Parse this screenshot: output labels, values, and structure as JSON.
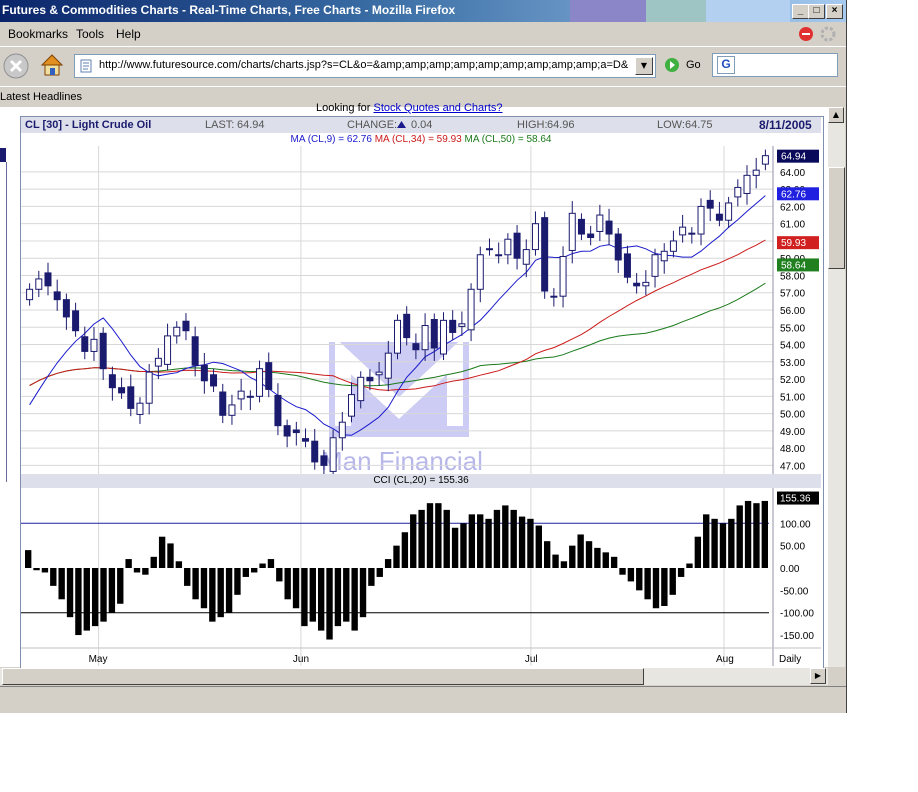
{
  "window": {
    "title": "Futures & Commodities Charts - Real-Time Charts, Free Charts - Mozilla Firefox",
    "min": "_",
    "max": "□",
    "close": "×"
  },
  "menu": [
    "Bookmarks",
    "Tools",
    "Help"
  ],
  "nav": {
    "url": "http://www.futuresource.com/charts/charts.jsp?s=CL&o=&amp;amp;amp;amp;amp;amp;amp;amp;amp;a=D&",
    "go_label": "Go",
    "search_value": "G"
  },
  "bookmarks": {
    "item": "Latest Headlines"
  },
  "page": {
    "link_prefix": "Looking for ",
    "link_text": "Stock Quotes and Charts?"
  },
  "chart_header": {
    "symbol": "CL [30] - Light Crude Oil",
    "last_label": "LAST:",
    "last": "64.94",
    "change_label": "CHANGE:",
    "change": "0.04",
    "high_label": "HIGH:",
    "high": "64.96",
    "low_label": "LOW:",
    "low": "64.75",
    "date": "8/11/2005"
  },
  "ma_legend": {
    "ma9": "MA (CL,9) = 62.76",
    "ma34": "MA (CL,34) = 59.93",
    "ma50": "MA (CL,50) = 58.64",
    "colors": {
      "ma9": "#1a1acc",
      "ma34": "#cc1a1a",
      "ma50": "#1a7a1a",
      "candle": "#1a1a6e"
    }
  },
  "cci_header": "CCI (CL,20) = 155.36",
  "watermark": {
    "text": "Man Financial"
  },
  "chart_data": [
    {
      "type": "candlestick",
      "title": "CL [30] - Light Crude Oil",
      "ylim": [
        46.5,
        65.5
      ],
      "y_ticks": [
        "47.00",
        "48.00",
        "49.00",
        "50.00",
        "51.00",
        "52.00",
        "53.00",
        "54.00",
        "55.00",
        "56.00",
        "57.00",
        "58.00",
        "59.00",
        "60.00",
        "61.00",
        "62.00",
        "63.00",
        "64.00"
      ],
      "price_badges": {
        "last": "64.94",
        "ma9": "62.76",
        "ma34": "59.93",
        "ma50": "58.64"
      },
      "x_labels": [
        "May",
        "Jun",
        "Jul",
        "Aug",
        "Daily"
      ],
      "closes": [
        57.2,
        57.8,
        57.4,
        56.6,
        55.6,
        54.8,
        53.6,
        54.3,
        52.6,
        51.5,
        51.2,
        50.3,
        50.6,
        52.4,
        53.2,
        54.5,
        55.0,
        54.8,
        52.8,
        51.9,
        51.6,
        49.9,
        50.5,
        51.3,
        51.0,
        52.6,
        51.4,
        49.3,
        48.7,
        48.9,
        48.4,
        47.2,
        47.0,
        48.6,
        49.5,
        51.1,
        52.1,
        51.9,
        52.4,
        53.5,
        55.4,
        54.4,
        53.7,
        55.1,
        53.8,
        55.4,
        54.7,
        55.2,
        57.2,
        59.2,
        59.5,
        59.2,
        60.1,
        59.0,
        59.5,
        61.0,
        57.1,
        56.8,
        59.1,
        61.6,
        60.4,
        60.2,
        61.5,
        60.4,
        58.9,
        57.9,
        57.4,
        57.6,
        59.2,
        59.4,
        60.0,
        60.8,
        60.4,
        62.0,
        61.9,
        61.2,
        62.2,
        63.1,
        63.8,
        64.1,
        64.94
      ]
    },
    {
      "type": "bar",
      "title": "CCI (CL,20) = 155.36",
      "ylim": [
        -170,
        170
      ],
      "y_ticks": [
        "100.00",
        "50.00",
        "0.00",
        "-50.00",
        "-100.00",
        "-150.00"
      ],
      "reference_lines": [
        100,
        -100
      ],
      "last_badge": "155.36",
      "values": [
        40,
        -5,
        -10,
        -40,
        -70,
        -110,
        -150,
        -140,
        -130,
        -120,
        -100,
        -80,
        20,
        -10,
        -15,
        25,
        70,
        55,
        15,
        -40,
        -70,
        -90,
        -120,
        -110,
        -100,
        -60,
        -20,
        -10,
        10,
        20,
        -30,
        -70,
        -90,
        -130,
        -120,
        -140,
        -160,
        -130,
        -120,
        -140,
        -110,
        -40,
        -20,
        20,
        50,
        80,
        120,
        130,
        145,
        145,
        130,
        90,
        100,
        120,
        120,
        110,
        130,
        140,
        130,
        115,
        110,
        95,
        60,
        30,
        15,
        50,
        75,
        60,
        45,
        35,
        25,
        -15,
        -30,
        -50,
        -70,
        -90,
        -85,
        -60,
        -20,
        10,
        70,
        120,
        110,
        100,
        110,
        140,
        150,
        145,
        150
      ]
    }
  ]
}
